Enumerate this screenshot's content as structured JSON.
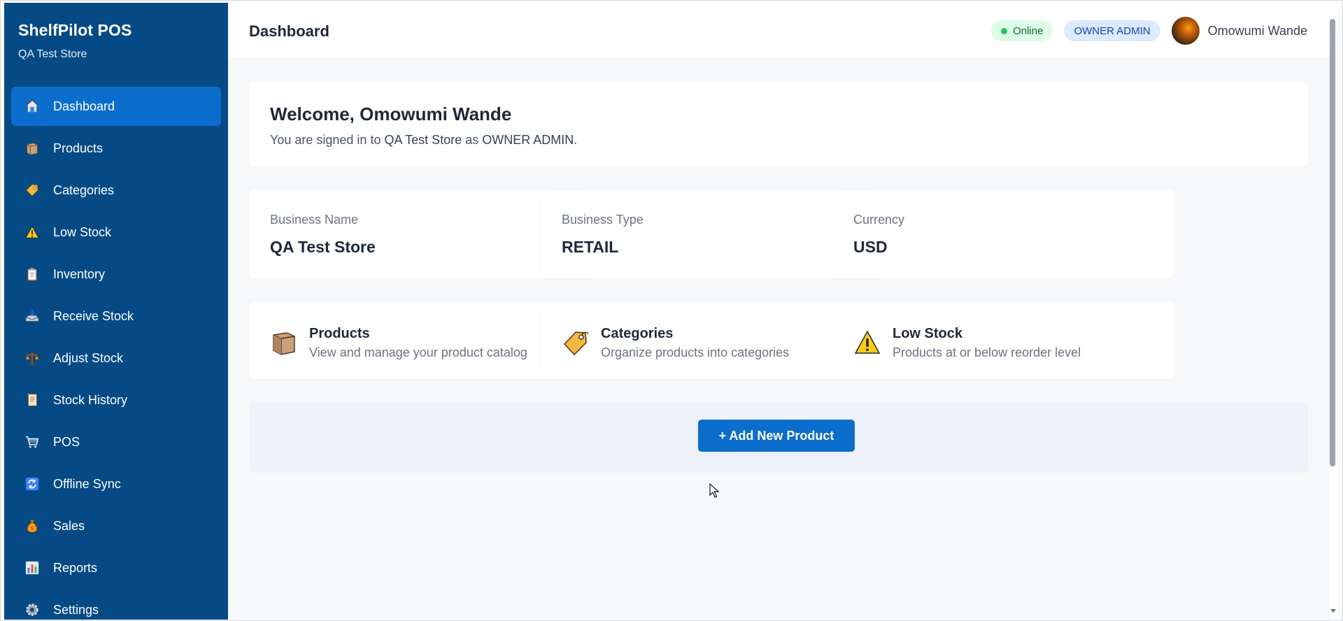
{
  "app": {
    "title": "ShelfPilot POS",
    "store": "QA Test Store"
  },
  "sidebar": {
    "items": [
      {
        "label": "Dashboard",
        "icon": "home-icon",
        "active": true
      },
      {
        "label": "Products",
        "icon": "box-icon"
      },
      {
        "label": "Categories",
        "icon": "tag-icon"
      },
      {
        "label": "Low Stock",
        "icon": "warning-icon"
      },
      {
        "label": "Inventory",
        "icon": "clipboard-icon"
      },
      {
        "label": "Receive Stock",
        "icon": "inbox-tray-icon"
      },
      {
        "label": "Adjust Stock",
        "icon": "scale-icon"
      },
      {
        "label": "Stock History",
        "icon": "scroll-icon"
      },
      {
        "label": "POS",
        "icon": "cart-icon"
      },
      {
        "label": "Offline Sync",
        "icon": "sync-icon"
      },
      {
        "label": "Sales",
        "icon": "money-bag-icon"
      },
      {
        "label": "Reports",
        "icon": "bar-chart-icon"
      },
      {
        "label": "Settings",
        "icon": "gear-icon"
      }
    ]
  },
  "header": {
    "title": "Dashboard",
    "status": "Online",
    "role": "OWNER ADMIN",
    "user": "Omowumi Wande",
    "colors": {
      "online_bg": "#dcfce7",
      "online_dot": "#22c55e",
      "role_bg": "#dbeafe"
    }
  },
  "welcome": {
    "title": "Welcome, Omowumi Wande",
    "prefix": "You are signed in to",
    "store": "QA Test Store",
    "middle": "as",
    "role": "OWNER ADMIN",
    "suffix": "."
  },
  "info_cards": [
    {
      "label": "Business Name",
      "value": "QA Test Store"
    },
    {
      "label": "Business Type",
      "value": "RETAIL"
    },
    {
      "label": "Currency",
      "value": "USD"
    }
  ],
  "link_cards": [
    {
      "title": "Products",
      "desc": "View and manage your product catalog",
      "icon": "box-icon"
    },
    {
      "title": "Categories",
      "desc": "Organize products into categories",
      "icon": "tag-icon"
    },
    {
      "title": "Low Stock",
      "desc": "Products at or below reorder level",
      "icon": "warning-icon"
    }
  ],
  "cta": {
    "label": "+ Add New Product"
  },
  "theme": {
    "sidebar_bg": "#054a85",
    "active_bg": "#0b6dcc",
    "accent": "#0b6dcc"
  }
}
